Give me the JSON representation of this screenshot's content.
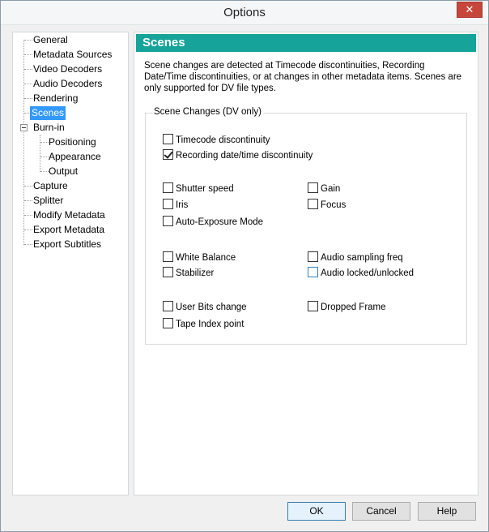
{
  "window": {
    "title": "Options",
    "close_glyph": "✕"
  },
  "tree": {
    "items": [
      {
        "label": "General"
      },
      {
        "label": "Metadata Sources"
      },
      {
        "label": "Video Decoders"
      },
      {
        "label": "Audio Decoders"
      },
      {
        "label": "Rendering"
      },
      {
        "label": "Scenes",
        "selected": true
      },
      {
        "label": "Burn-in",
        "expanded": true
      },
      {
        "label": "Positioning"
      },
      {
        "label": "Appearance"
      },
      {
        "label": "Output"
      },
      {
        "label": "Capture"
      },
      {
        "label": "Splitter"
      },
      {
        "label": "Modify Metadata"
      },
      {
        "label": "Export Metadata"
      },
      {
        "label": "Export Subtitles"
      }
    ]
  },
  "panel": {
    "header": "Scenes",
    "description": "Scene changes are detected at Timecode discontinuities, Recording Date/Time discontinuities, or at changes in other metadata items. Scenes are only supported for DV file types.",
    "group_title": "Scene Changes (DV only)",
    "checkboxes": {
      "timecode": {
        "label": "Timecode discontinuity",
        "checked": false
      },
      "recording": {
        "label": "Recording date/time discontinuity",
        "checked": true
      },
      "shutter": {
        "label": "Shutter speed",
        "checked": false
      },
      "gain": {
        "label": "Gain",
        "checked": false
      },
      "iris": {
        "label": "Iris",
        "checked": false
      },
      "focus": {
        "label": "Focus",
        "checked": false
      },
      "autoexp": {
        "label": "Auto-Exposure Mode",
        "checked": false
      },
      "whitebal": {
        "label": "White Balance",
        "checked": false
      },
      "audiosamp": {
        "label": "Audio sampling freq",
        "checked": false
      },
      "stabilizer": {
        "label": "Stabilizer",
        "checked": false
      },
      "audiolock": {
        "label": "Audio locked/unlocked",
        "checked": false
      },
      "userbits": {
        "label": "User Bits change",
        "checked": false
      },
      "dropped": {
        "label": "Dropped Frame",
        "checked": false
      },
      "tapeindex": {
        "label": "Tape Index point",
        "checked": false
      }
    }
  },
  "buttons": {
    "ok": "OK",
    "cancel": "Cancel",
    "help": "Help"
  },
  "colors": {
    "header_bg": "#16a399",
    "selection_bg": "#3399ff"
  }
}
